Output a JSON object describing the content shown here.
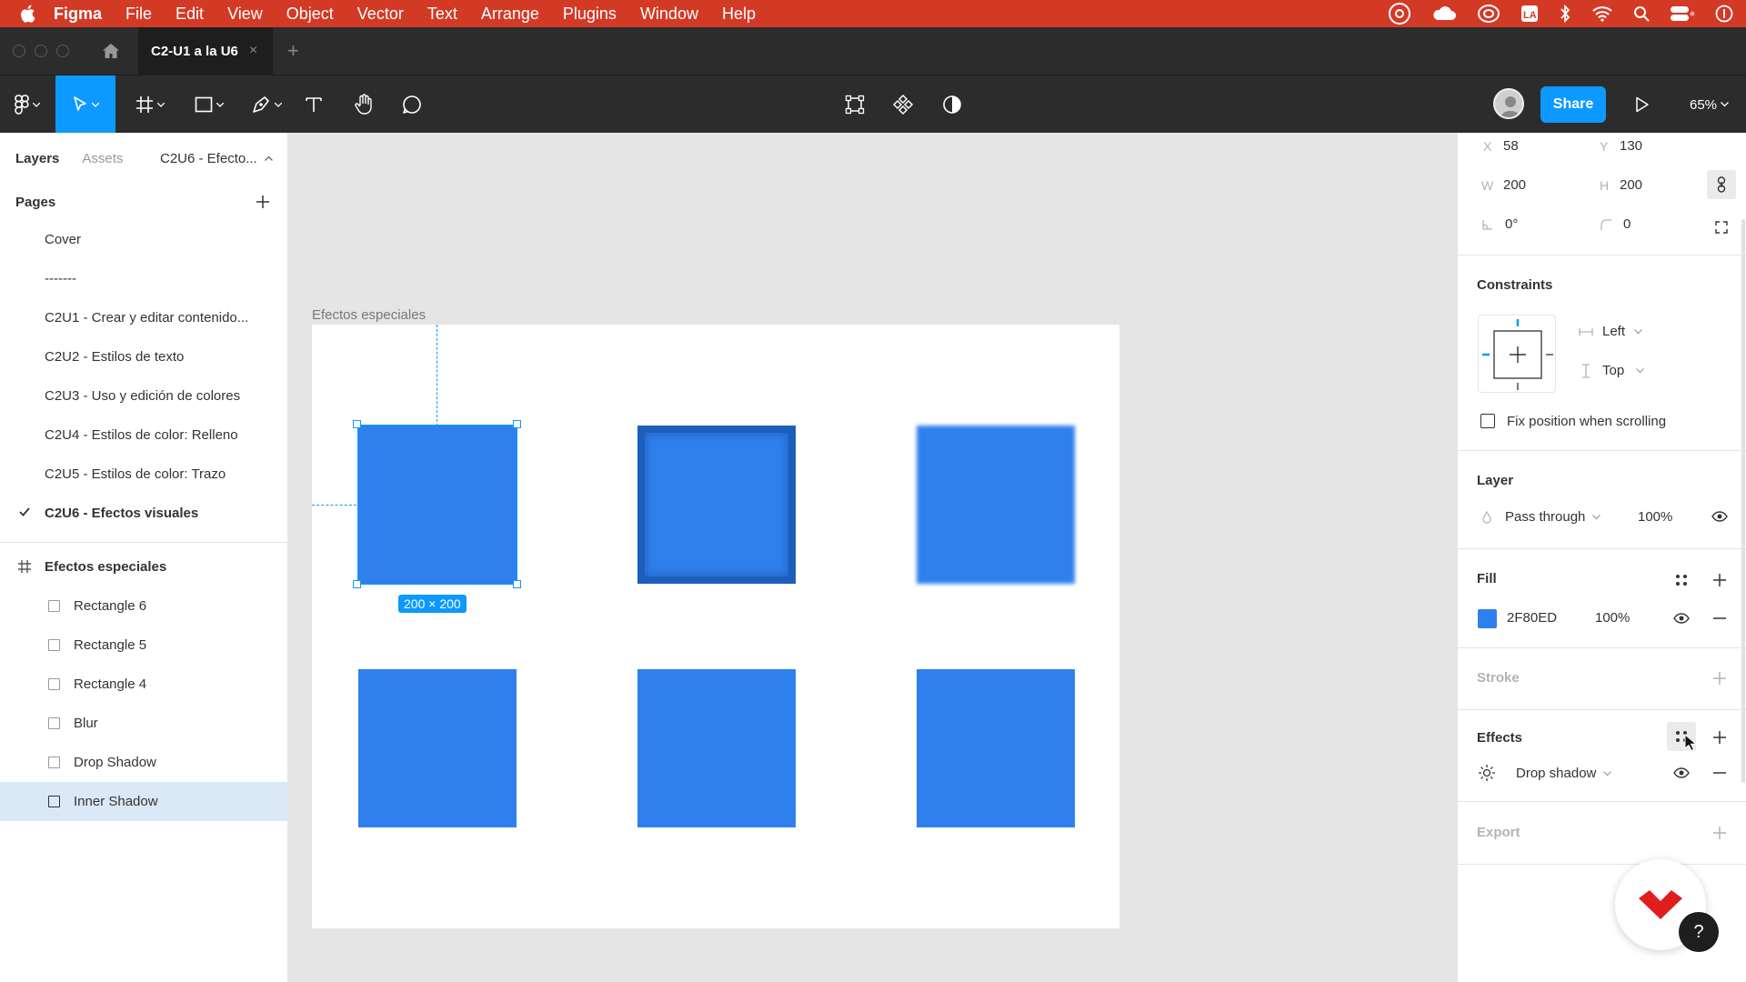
{
  "menubar": {
    "app": "Figma",
    "items": [
      "File",
      "Edit",
      "View",
      "Object",
      "Vector",
      "Text",
      "Arrange",
      "Plugins",
      "Window",
      "Help"
    ]
  },
  "tabbar": {
    "file_tab": "C2-U1 a la U6"
  },
  "toolbar": {
    "share": "Share",
    "zoom": "65%"
  },
  "left_panel": {
    "tab_layers": "Layers",
    "tab_assets": "Assets",
    "current_page": "C2U6 - Efecto...",
    "pages_title": "Pages",
    "pages": [
      "Cover",
      "-------",
      "C2U1 - Crear y editar contenido...",
      "C2U2 - Estilos de texto",
      "C2U3 - Uso y edición de colores",
      "C2U4 - Estilos de color: Relleno",
      "C2U5 - Estilos de color: Trazo",
      "C2U6 - Efectos visuales"
    ],
    "frame_name": "Efectos especiales",
    "layers": [
      "Rectangle 6",
      "Rectangle 5",
      "Rectangle 4",
      "Blur",
      "Drop Shadow",
      "Inner Shadow"
    ]
  },
  "canvas": {
    "frame_label": "Efectos especiales",
    "selection_size": "200 × 200",
    "fill_color": "#2F80ED"
  },
  "right_panel": {
    "x_label": "X",
    "x": "58",
    "y_label": "Y",
    "y": "130",
    "w_label": "W",
    "w": "200",
    "h_label": "H",
    "h": "200",
    "rotation": "0°",
    "radius": "0",
    "constraints_title": "Constraints",
    "constraint_h": "Left",
    "constraint_v": "Top",
    "fix_position": "Fix position when scrolling",
    "layer_title": "Layer",
    "blend_mode": "Pass through",
    "layer_opacity": "100%",
    "fill_title": "Fill",
    "fill_hex": "2F80ED",
    "fill_opacity": "100%",
    "stroke_title": "Stroke",
    "effects_title": "Effects",
    "effect_type": "Drop shadow",
    "export_title": "Export"
  },
  "help": {
    "q": "?"
  }
}
